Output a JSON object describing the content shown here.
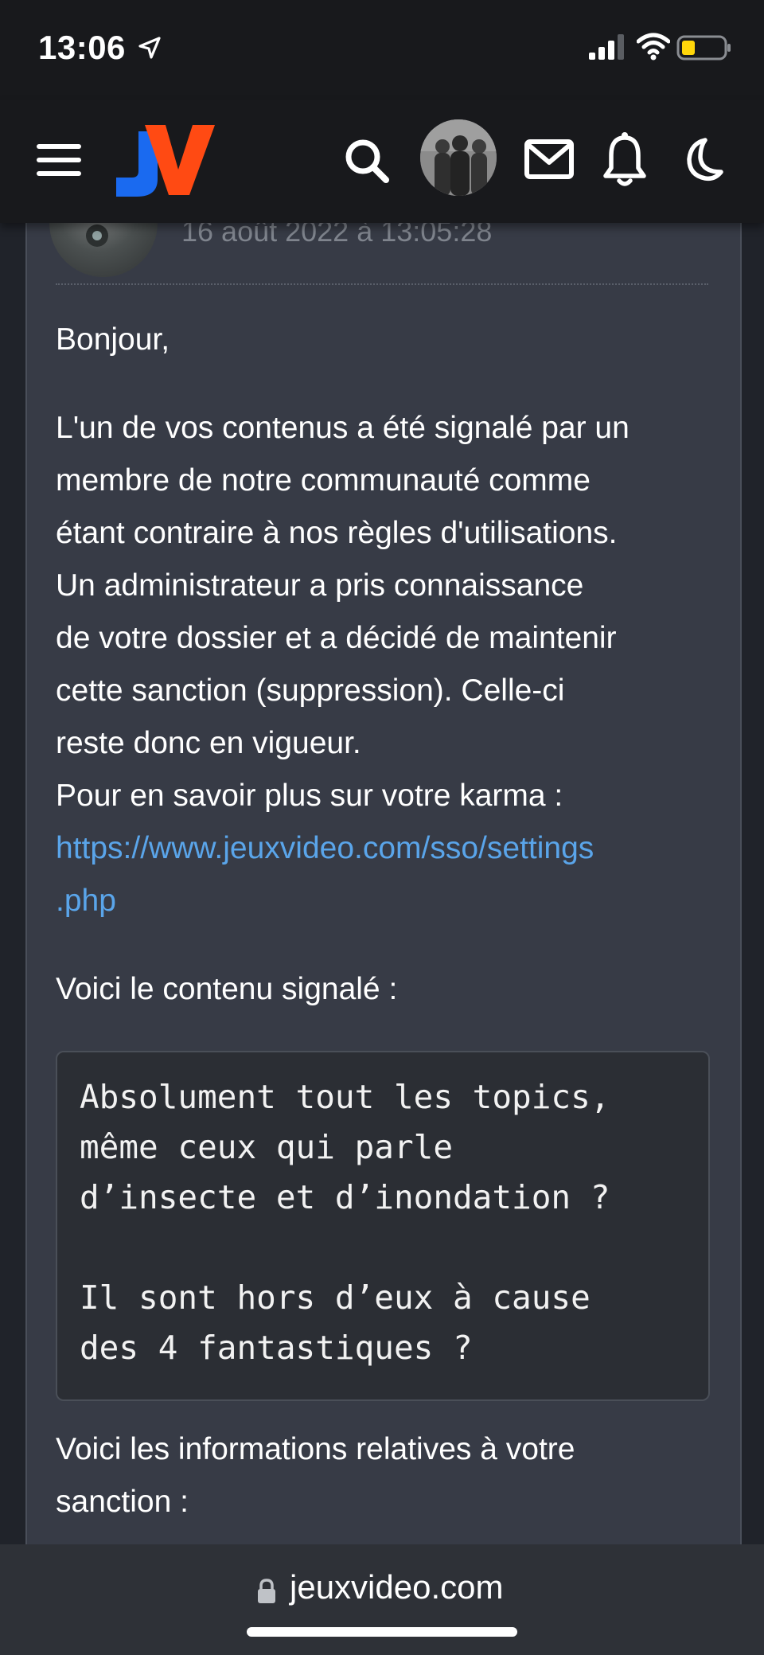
{
  "status_bar": {
    "time": "13:06"
  },
  "header": {
    "logo_text": "JV"
  },
  "message": {
    "date": "16 août 2022 à 13:05:28",
    "greeting": "Bonjour,",
    "paragraph_lines": [
      "L'un de vos contenus a été signalé par un",
      "membre de notre communauté comme",
      "étant contraire à nos règles d'utilisations.",
      "Un administrateur a pris connaissance",
      "de votre dossier et a décidé de maintenir",
      "cette sanction (suppression). Celle-ci",
      "reste donc en vigueur.",
      "Pour en savoir plus sur votre karma :"
    ],
    "link_lines": [
      "https://www.jeuxvideo.com/sso/settings",
      ".php"
    ],
    "reported_intro": "Voici le contenu signalé :",
    "quote_lines": [
      "Absolument tout les topics,",
      "même ceux qui parle",
      "d’insecte et d’inondation ?",
      "",
      "Il sont hors d’eux à cause",
      "des 4 fantastiques ?"
    ],
    "sanction_lines": [
      "Voici les informations relatives à votre",
      "sanction :"
    ]
  },
  "browser": {
    "domain": "jeuxvideo.com"
  },
  "colors": {
    "link": "#5aa5ea",
    "card_bg": "#373b46",
    "logo_blue": "#1a6af0",
    "logo_orange": "#ff4a13"
  }
}
